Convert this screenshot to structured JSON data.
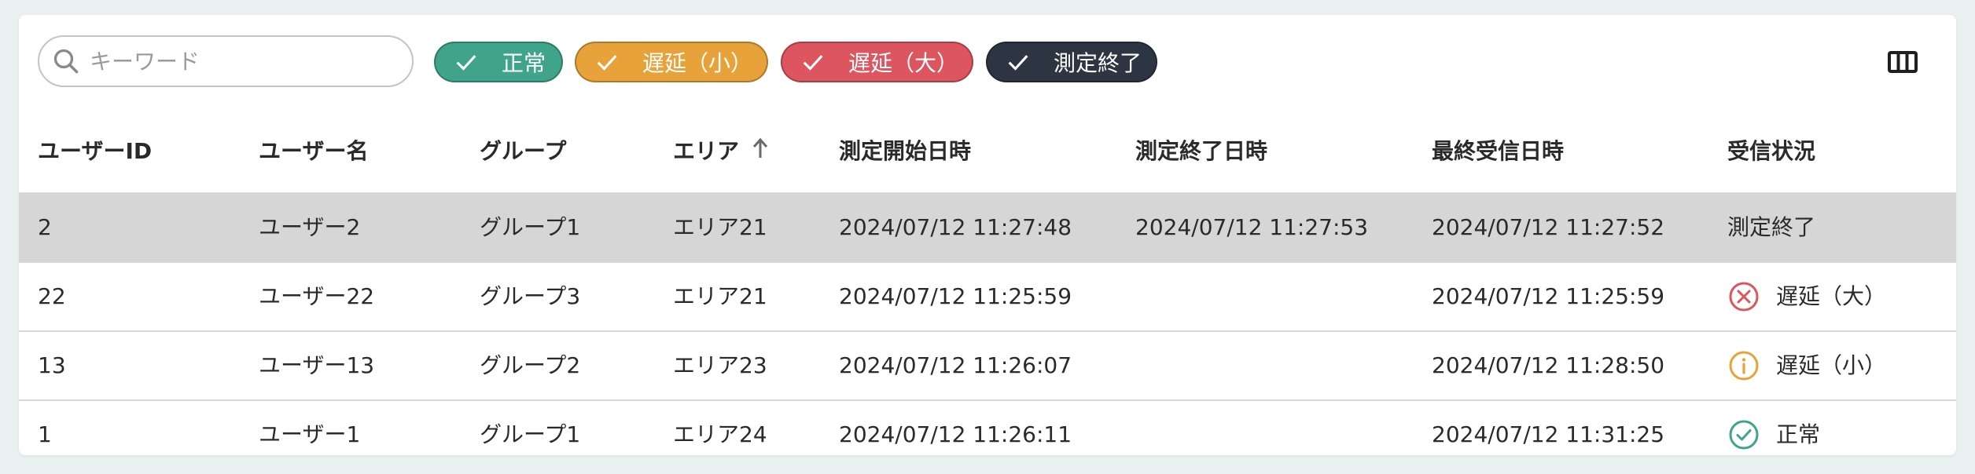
{
  "search": {
    "placeholder": "キーワード",
    "value": ""
  },
  "filters": [
    {
      "label": "正常",
      "color": "#3fa48a",
      "checked": true
    },
    {
      "label": "遅延（小）",
      "color": "#e8a23a",
      "checked": true
    },
    {
      "label": "遅延（大）",
      "color": "#dd555e",
      "checked": true
    },
    {
      "label": "測定終了",
      "color": "#2d3542",
      "checked": true
    }
  ],
  "toolbar": {
    "columns_icon": "view-column-icon"
  },
  "table": {
    "headers": [
      "ユーザーID",
      "ユーザー名",
      "グループ",
      "エリア",
      "測定開始日時",
      "測定終了日時",
      "最終受信日時",
      "受信状況"
    ],
    "sort": {
      "column": "エリア",
      "direction": "ascending"
    },
    "rows": [
      {
        "id": "2",
        "name": "ユーザー2",
        "group": "グループ1",
        "area": "エリア21",
        "start": "2024/07/12 11:27:48",
        "end": "2024/07/12 11:27:53",
        "last": "2024/07/12 11:27:52",
        "status": "測定終了",
        "status_icon": "",
        "selected": true
      },
      {
        "id": "22",
        "name": "ユーザー22",
        "group": "グループ3",
        "area": "エリア21",
        "start": "2024/07/12 11:25:59",
        "end": "",
        "last": "2024/07/12 11:25:59",
        "status": "遅延（大）",
        "status_icon": "error-circle-icon",
        "status_color": "#dd555e"
      },
      {
        "id": "13",
        "name": "ユーザー13",
        "group": "グループ2",
        "area": "エリア23",
        "start": "2024/07/12 11:26:07",
        "end": "",
        "last": "2024/07/12 11:28:50",
        "status": "遅延（小）",
        "status_icon": "info-circle-icon",
        "status_color": "#e8a23a"
      },
      {
        "id": "1",
        "name": "ユーザー1",
        "group": "グループ1",
        "area": "エリア24",
        "start": "2024/07/12 11:26:11",
        "end": "",
        "last": "2024/07/12 11:31:25",
        "status": "正常",
        "status_icon": "check-circle-icon",
        "status_color": "#3fa48a"
      }
    ]
  }
}
